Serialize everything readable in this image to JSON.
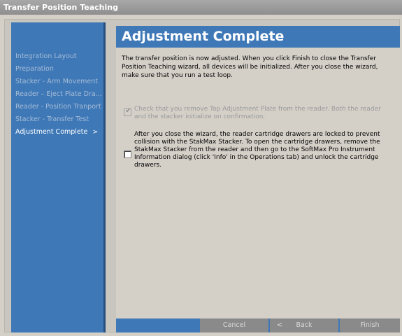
{
  "window": {
    "title": "Transfer Position Teaching"
  },
  "sidebar": {
    "items": [
      {
        "label": "Integration Layout",
        "active": false
      },
      {
        "label": "Preparation",
        "active": false
      },
      {
        "label": "Stacker - Arm Movement",
        "active": false
      },
      {
        "label": "Reader – Eject Plate Dra...",
        "active": false
      },
      {
        "label": "Reader - Position Tranport",
        "active": false
      },
      {
        "label": "Stacker - Transfer Test",
        "active": false
      },
      {
        "label": "Adjustment Complete",
        "active": true,
        "chevron": ">"
      }
    ]
  },
  "page": {
    "title": "Adjustment Complete",
    "intro": "The transfer position is now adjusted. When you click Finish to close the Transfer Position Teaching wizard, all devices will be initialized. After you close the wizard, make sure that you run a test loop.",
    "checkboxes": [
      {
        "text": "Check that you remove Top Adjustment Plate from the reader. Both the reader and the stacker initialize on confirmation.",
        "checked": true,
        "enabled": false
      },
      {
        "text": "After you close the wizard, the reader cartridge drawers are locked to prevent collision with the StakMax Stacker. To open the cartridge drawers, remove the StakMax Stacker from the reader and then go to the SoftMax Pro Instrument Information dialog (click 'Info' in the Operations tab) and unlock the cartridge drawers.",
        "checked": false,
        "enabled": true
      }
    ]
  },
  "footer": {
    "cancel_label": "Cancel",
    "back_label": "Back",
    "back_arrow": "<",
    "finish_label": "Finish"
  },
  "colors": {
    "accent_blue": "#3e78b7",
    "dialog_gray": "#d4d0c8",
    "disabled_button": "#8a8a8a"
  }
}
